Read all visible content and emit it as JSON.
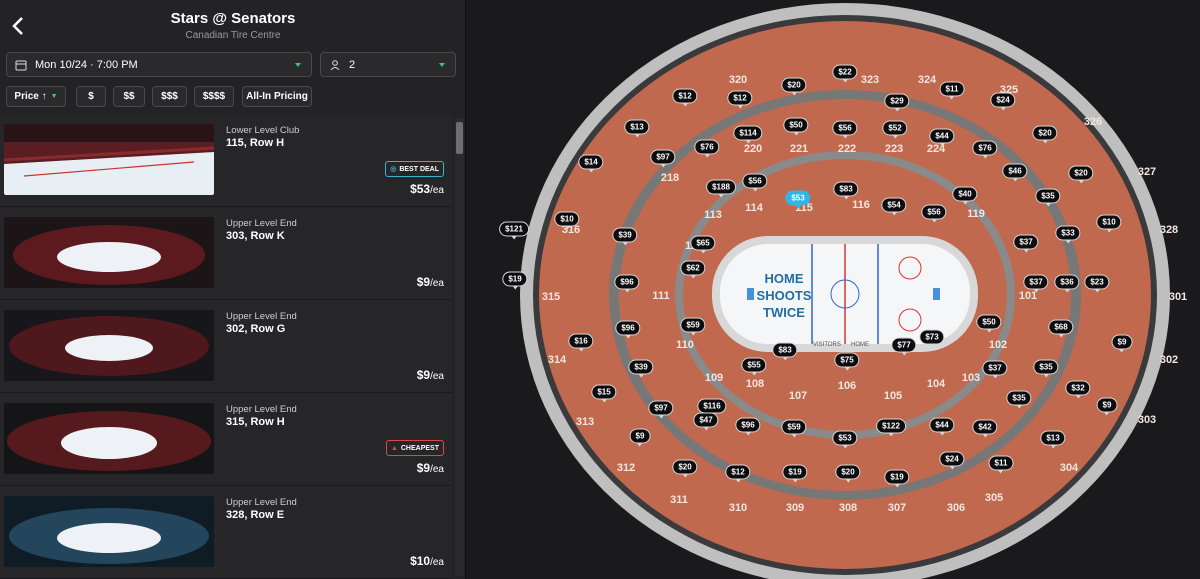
{
  "header": {
    "title": "Stars @ Senators",
    "venue": "Canadian Tire Centre"
  },
  "filters": {
    "date": "Mon 10/24 · 7:00 PM",
    "quantity": "2",
    "sort": "Price",
    "chips": [
      "$",
      "$$",
      "$$$",
      "$$$$",
      "All-In Pricing"
    ]
  },
  "listings": [
    {
      "category": "Lower Level Club",
      "section_row": "115, Row H",
      "price": "$53",
      "unit": "/ea",
      "badge": "BEST DEAL"
    },
    {
      "category": "Upper Level End",
      "section_row": "303, Row K",
      "price": "$9",
      "unit": "/ea",
      "badge": ""
    },
    {
      "category": "Upper Level End",
      "section_row": "302, Row G",
      "price": "$9",
      "unit": "/ea",
      "badge": ""
    },
    {
      "category": "Upper Level End",
      "section_row": "315, Row H",
      "price": "$9",
      "unit": "/ea",
      "badge": "CHEAPEST"
    },
    {
      "category": "Upper Level End",
      "section_row": "328, Row E",
      "price": "$10",
      "unit": "/ea",
      "badge": ""
    }
  ],
  "map": {
    "ice_text": "HOME\nSHOOTS\nTWICE",
    "ice_labels": {
      "visitors": "VISITORS",
      "home": "HOME"
    },
    "sections": [
      "320",
      "323",
      "324",
      "325",
      "326",
      "327",
      "328",
      "301",
      "302",
      "303",
      "304",
      "305",
      "306",
      "307",
      "308",
      "309",
      "310",
      "311",
      "312",
      "313",
      "314",
      "315",
      "316",
      "114",
      "115",
      "116",
      "113",
      "112",
      "111",
      "110",
      "109",
      "108",
      "107",
      "106",
      "105",
      "104",
      "103",
      "102",
      "101",
      "119",
      "220",
      "221",
      "222",
      "223",
      "224",
      "218"
    ],
    "pins": [
      "$22",
      "$20",
      "$29",
      "$12",
      "$11",
      "$24",
      "$12",
      "$13",
      "$50",
      "$56",
      "$52",
      "$44",
      "$114",
      "$76",
      "$20",
      "$14",
      "$97",
      "$76",
      "$56",
      "$188",
      "$83",
      "$40",
      "$46",
      "$20",
      "$53",
      "$54",
      "$56",
      "$35",
      "$10",
      "$121",
      "$10",
      "$39",
      "$65",
      "$37",
      "$33",
      "$62",
      "$9",
      "$96",
      "$37",
      "$36",
      "$23",
      "$96",
      "$59",
      "$50",
      "$68",
      "$16",
      "$83",
      "$77",
      "$73",
      "$9",
      "$39",
      "$55",
      "$75",
      "$37",
      "$35",
      "$15",
      "$97",
      "$116",
      "$47",
      "$96",
      "$59",
      "$53",
      "$122",
      "$44",
      "$42",
      "$35",
      "$9",
      "$13",
      "$32",
      "$20",
      "$12",
      "$19",
      "$20",
      "$19",
      "$24",
      "$11",
      "$19"
    ]
  }
}
